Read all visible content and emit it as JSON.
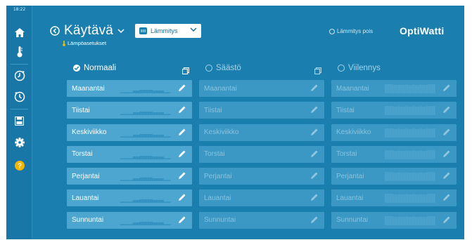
{
  "status_bar": {
    "time": "18:22"
  },
  "sidebar": {
    "items": [
      {
        "icon": "home-icon"
      },
      {
        "icon": "thermometer-icon"
      },
      {
        "icon": "schedule-forward-icon"
      },
      {
        "icon": "schedule-back-icon"
      },
      {
        "icon": "save-icon"
      },
      {
        "icon": "gear-icon"
      },
      {
        "icon": "help-icon"
      }
    ]
  },
  "header": {
    "title": "Käytävä",
    "subtitle": "Lämpöasetukset",
    "mode_select": {
      "value": "Lämmitys"
    },
    "heating_off_label": "Lämmitys pois",
    "logo": "OptiWatti"
  },
  "columns": [
    {
      "label": "Normaali",
      "selected": true
    },
    {
      "label": "Säästö",
      "selected": false
    },
    {
      "label": "Viilennys",
      "selected": false
    }
  ],
  "days": [
    "Maanantai",
    "Tiistai",
    "Keskiviikko",
    "Torstai",
    "Perjantai",
    "Lauantai",
    "Sunnuntai"
  ],
  "colors": {
    "background": "#1a7fae",
    "active_row": "#4da6cf",
    "inactive_row": "#3b98c4",
    "select_text": "#1a6f99"
  }
}
